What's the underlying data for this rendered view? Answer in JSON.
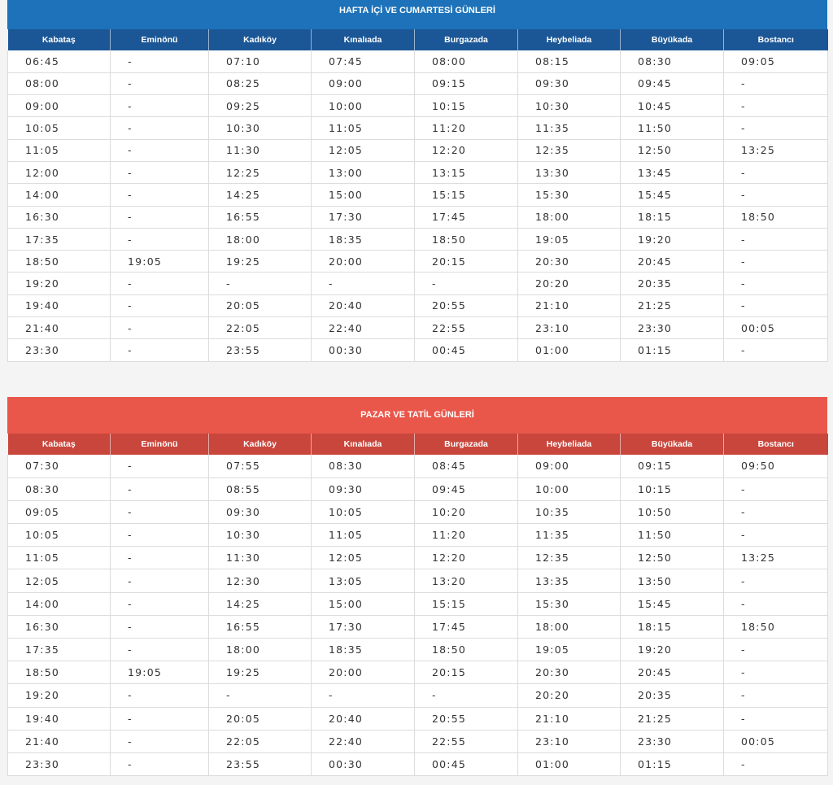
{
  "columns": [
    "Kabataş",
    "Eminönü",
    "Kadıköy",
    "Kınalıada",
    "Burgazada",
    "Heybeliada",
    "Büyükada",
    "Bostancı"
  ],
  "weekday": {
    "title": "HAFTA İÇİ VE CUMARTESİ GÜNLERİ",
    "rows": [
      [
        "06:45",
        "-",
        "07:10",
        "07:45",
        "08:00",
        "08:15",
        "08:30",
        "09:05"
      ],
      [
        "08:00",
        "-",
        "08:25",
        "09:00",
        "09:15",
        "09:30",
        "09:45",
        "-"
      ],
      [
        "09:00",
        "-",
        "09:25",
        "10:00",
        "10:15",
        "10:30",
        "10:45",
        "-"
      ],
      [
        "10:05",
        "-",
        "10:30",
        "11:05",
        "11:20",
        "11:35",
        "11:50",
        "-"
      ],
      [
        "11:05",
        "-",
        "11:30",
        "12:05",
        "12:20",
        "12:35",
        "12:50",
        "13:25"
      ],
      [
        "12:00",
        "-",
        "12:25",
        "13:00",
        "13:15",
        "13:30",
        "13:45",
        "-"
      ],
      [
        "14:00",
        "-",
        "14:25",
        "15:00",
        "15:15",
        "15:30",
        "15:45",
        "-"
      ],
      [
        "16:30",
        "-",
        "16:55",
        "17:30",
        "17:45",
        "18:00",
        "18:15",
        "18:50"
      ],
      [
        "17:35",
        "-",
        "18:00",
        "18:35",
        "18:50",
        "19:05",
        "19:20",
        "-"
      ],
      [
        "18:50",
        "19:05",
        "19:25",
        "20:00",
        "20:15",
        "20:30",
        "20:45",
        "-"
      ],
      [
        "19:20",
        "-",
        "-",
        "-",
        "-",
        "20:20",
        "20:35",
        "-"
      ],
      [
        "19:40",
        "-",
        "20:05",
        "20:40",
        "20:55",
        "21:10",
        "21:25",
        "-"
      ],
      [
        "21:40",
        "-",
        "22:05",
        "22:40",
        "22:55",
        "23:10",
        "23:30",
        "00:05"
      ],
      [
        "23:30",
        "-",
        "23:55",
        "00:30",
        "00:45",
        "01:00",
        "01:15",
        "-"
      ]
    ]
  },
  "holiday": {
    "title": "PAZAR  VE TATİL GÜNLERİ",
    "rows": [
      [
        "07:30",
        "-",
        "07:55",
        "08:30",
        "08:45",
        "09:00",
        "09:15",
        "09:50"
      ],
      [
        "08:30",
        "-",
        "08:55",
        "09:30",
        "09:45",
        "10:00",
        "10:15",
        "-"
      ],
      [
        "09:05",
        "-",
        "09:30",
        "10:05",
        "10:20",
        "10:35",
        "10:50",
        "-"
      ],
      [
        "10:05",
        "-",
        "10:30",
        "11:05",
        "11:20",
        "11:35",
        "11:50",
        "-"
      ],
      [
        "11:05",
        "-",
        "11:30",
        "12:05",
        "12:20",
        "12:35",
        "12:50",
        "13:25"
      ],
      [
        "12:05",
        "-",
        "12:30",
        "13:05",
        "13:20",
        "13:35",
        "13:50",
        "-"
      ],
      [
        "14:00",
        "-",
        "14:25",
        "15:00",
        "15:15",
        "15:30",
        "15:45",
        "-"
      ],
      [
        "16:30",
        "-",
        "16:55",
        "17:30",
        "17:45",
        "18:00",
        "18:15",
        "18:50"
      ],
      [
        "17:35",
        "-",
        "18:00",
        "18:35",
        "18:50",
        "19:05",
        "19:20",
        "-"
      ],
      [
        "18:50",
        "19:05",
        "19:25",
        "20:00",
        "20:15",
        "20:30",
        "20:45",
        "-"
      ],
      [
        "19:20",
        "-",
        "-",
        "-",
        "-",
        "20:20",
        "20:35",
        "-"
      ],
      [
        "19:40",
        "-",
        "20:05",
        "20:40",
        "20:55",
        "21:10",
        "21:25",
        "-"
      ],
      [
        "21:40",
        "-",
        "22:05",
        "22:40",
        "22:55",
        "23:10",
        "23:30",
        "00:05"
      ],
      [
        "23:30",
        "-",
        "23:55",
        "00:30",
        "00:45",
        "01:00",
        "01:15",
        "-"
      ]
    ]
  },
  "colors": {
    "weekday_title_bg": "#1d72b9",
    "weekday_header_bg": "#1b5796",
    "holiday_title_bg": "#e9574a",
    "holiday_header_bg": "#c9463c"
  }
}
